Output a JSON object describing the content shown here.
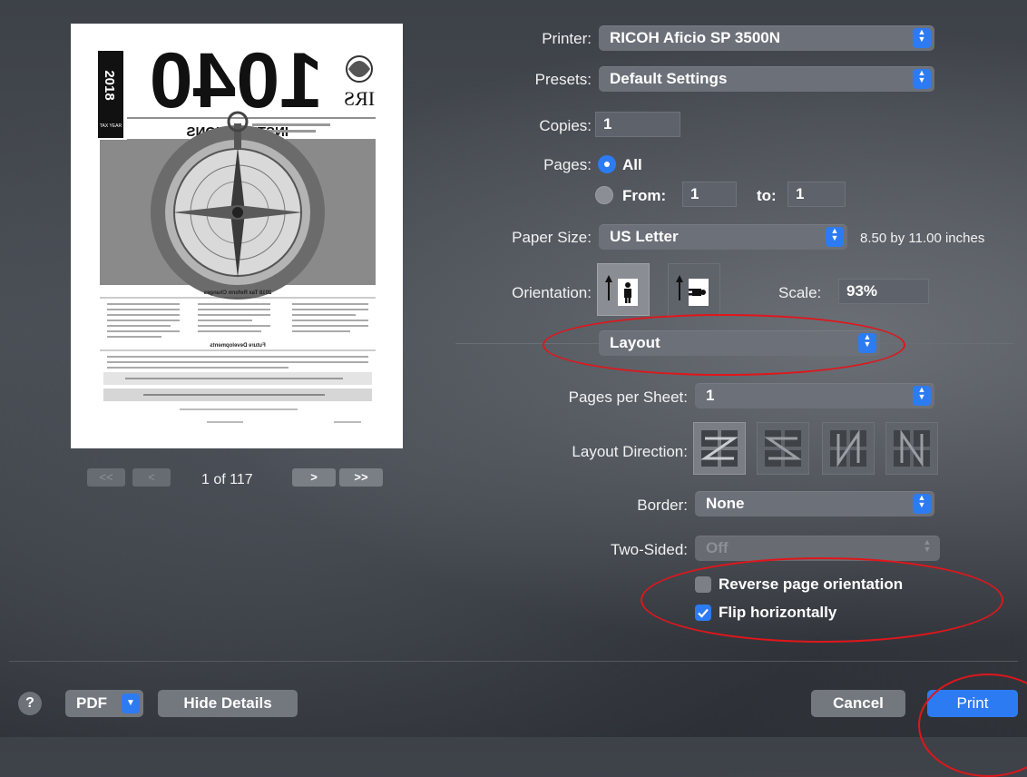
{
  "preview": {
    "page_indicator": "1 of 117",
    "nav": {
      "first": "<<",
      "prev": "<",
      "next": ">",
      "last": ">>"
    }
  },
  "document": {
    "year": "2018",
    "form_number": "1040",
    "agency": "IRS",
    "tax_year_tag": "TAX YEAR",
    "heading": "INSTRUCTIONS",
    "section1": "2018 Tax Reform Changes",
    "section2": "Future Developments"
  },
  "printer": {
    "label": "Printer:",
    "value": "RICOH Aficio SP 3500N"
  },
  "presets": {
    "label": "Presets:",
    "value": "Default Settings"
  },
  "copies": {
    "label": "Copies:",
    "value": "1"
  },
  "pages": {
    "label": "Pages:",
    "all_label": "All",
    "from_label": "From:",
    "from_value": "1",
    "to_label": "to:",
    "to_value": "1",
    "selected": "All"
  },
  "paper_size": {
    "label": "Paper Size:",
    "value": "US Letter",
    "dimensions": "8.50 by 11.00 inches"
  },
  "orientation": {
    "label": "Orientation:",
    "selected": "portrait"
  },
  "scale": {
    "label": "Scale:",
    "value": "93%"
  },
  "section_menu": {
    "value": "Layout"
  },
  "layout": {
    "pages_per_sheet": {
      "label": "Pages per Sheet:",
      "value": "1"
    },
    "layout_direction": {
      "label": "Layout Direction:"
    },
    "border": {
      "label": "Border:",
      "value": "None"
    },
    "two_sided": {
      "label": "Two-Sided:",
      "value": "Off",
      "enabled": false
    },
    "reverse_page_orientation": {
      "label": "Reverse page orientation",
      "checked": false
    },
    "flip_horizontally": {
      "label": "Flip horizontally",
      "checked": true
    }
  },
  "footer": {
    "help": "?",
    "pdf": "PDF",
    "hide_details": "Hide Details",
    "cancel": "Cancel",
    "print": "Print"
  },
  "colors": {
    "accent": "#2d7bf2",
    "annotation": "#e0161b"
  }
}
